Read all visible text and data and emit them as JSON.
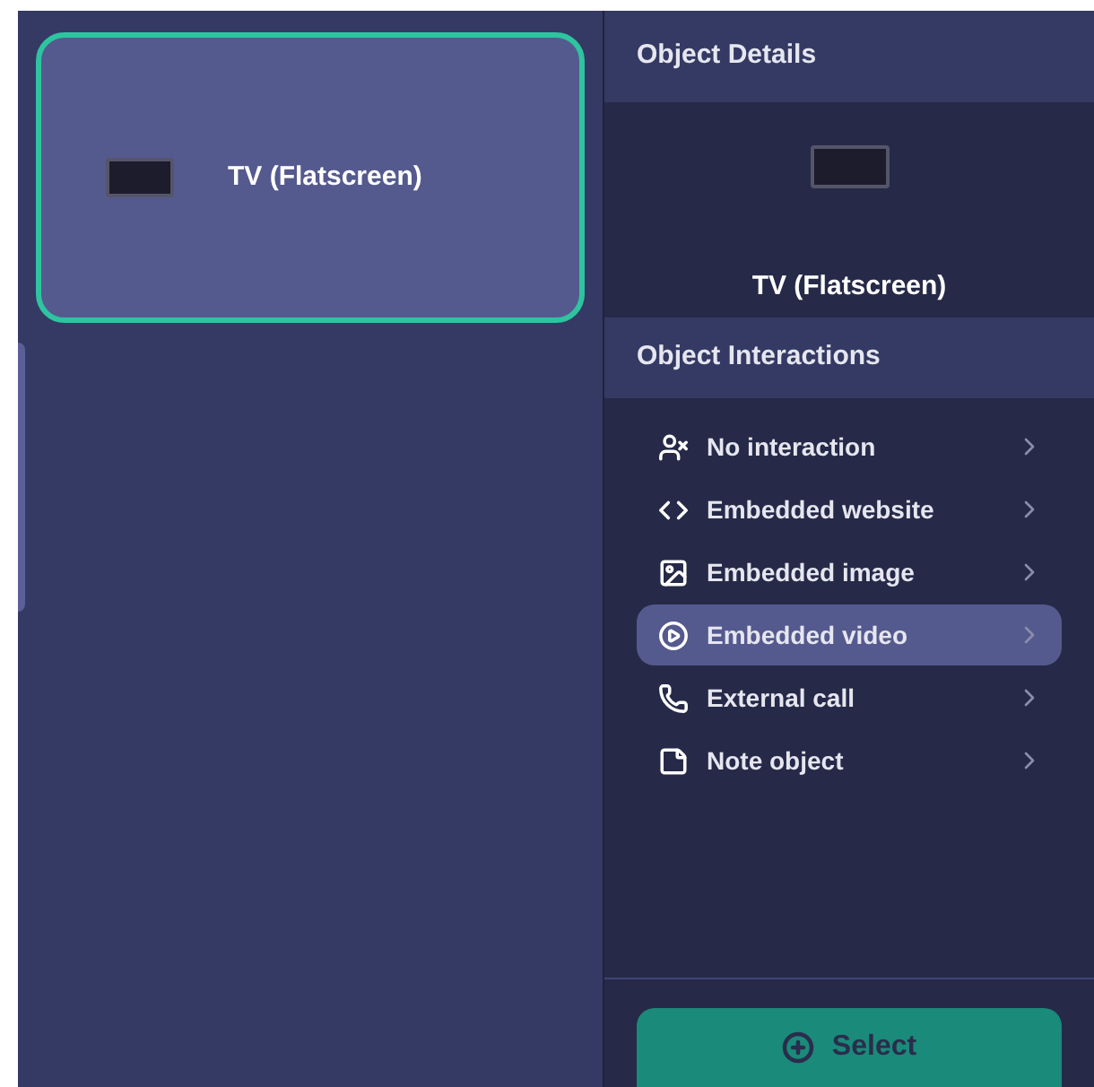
{
  "object_list": [
    {
      "name": "TV (Flatscreen)",
      "selected": true
    }
  ],
  "details": {
    "title": "Object Details",
    "object_name": "TV (Flatscreen)"
  },
  "interactions": {
    "title": "Object Interactions",
    "items": [
      {
        "kind": "none",
        "label": "No interaction",
        "selected": false
      },
      {
        "kind": "website",
        "label": "Embedded website",
        "selected": false
      },
      {
        "kind": "image",
        "label": "Embedded image",
        "selected": false
      },
      {
        "kind": "video",
        "label": "Embedded video",
        "selected": true
      },
      {
        "kind": "call",
        "label": "External call",
        "selected": false
      },
      {
        "kind": "note",
        "label": "Note object",
        "selected": false
      }
    ]
  },
  "select_button": {
    "label": "Select"
  }
}
